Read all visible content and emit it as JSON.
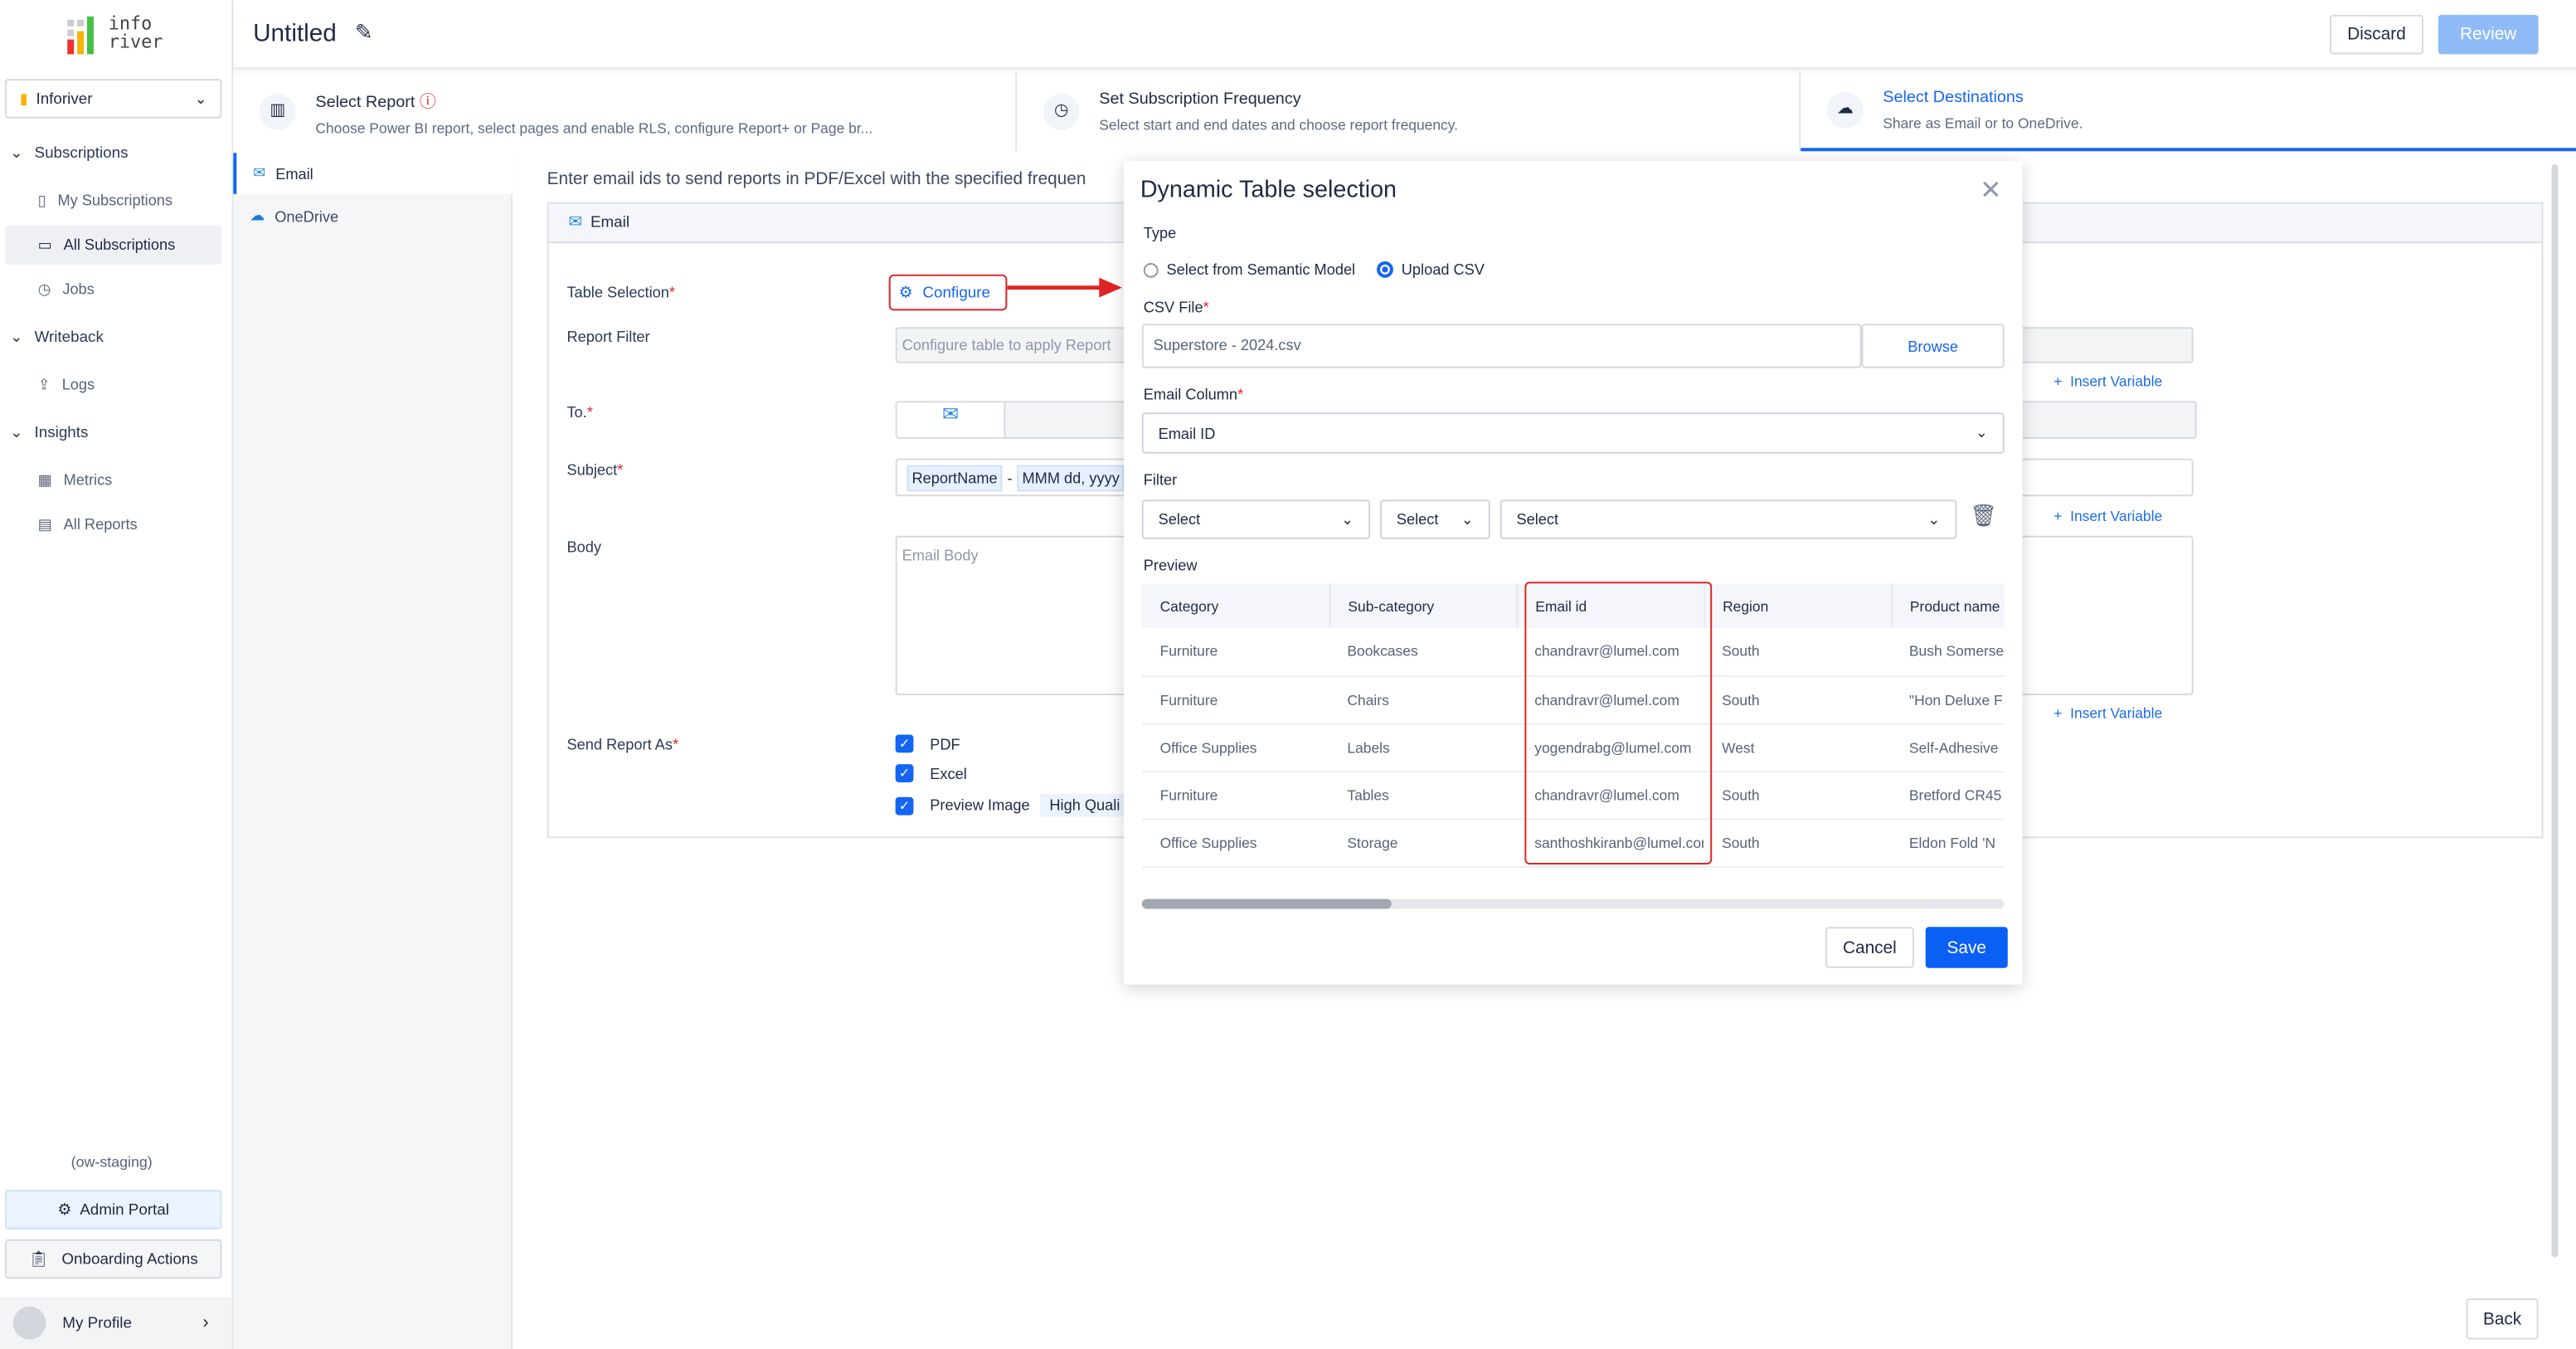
{
  "app": {
    "logo_text": "info river",
    "title": "Untitled",
    "discard": "Discard",
    "review": "Review",
    "back": "Back"
  },
  "sidebar": {
    "workspace": "Inforiver",
    "groups": [
      {
        "label": "Subscriptions",
        "items": [
          "My Subscriptions",
          "All Subscriptions",
          "Jobs"
        ]
      },
      {
        "label": "Writeback",
        "items": [
          "Logs"
        ]
      },
      {
        "label": "Insights",
        "items": [
          "Metrics",
          "All Reports"
        ]
      }
    ],
    "env": "(ow-staging)",
    "admin": "Admin Portal",
    "onboarding": "Onboarding Actions",
    "profile": "My Profile"
  },
  "steps": [
    {
      "title": "Select Report",
      "desc": "Choose Power BI report, select pages and enable RLS, configure Report+ or Page br..."
    },
    {
      "title": "Set Subscription Frequency",
      "desc": "Select start and end dates and choose report frequency."
    },
    {
      "title": "Select Destinations",
      "desc": "Share as Email or to OneDrive."
    }
  ],
  "destinations": [
    "Email",
    "OneDrive"
  ],
  "main": {
    "intro": "Enter email ids to send reports in PDF/Excel with the specified frequen",
    "panel_title": "Email",
    "table_selection": "Table Selection",
    "configure": "Configure",
    "report_filter": "Report Filter",
    "report_filter_placeholder": "Configure table to apply Report",
    "to": "To.",
    "subject": "Subject",
    "subject_tokens": [
      "ReportName",
      "-",
      "MMM dd, yyyy"
    ],
    "body": "Body",
    "body_placeholder": "Email Body",
    "send_as": "Send Report As",
    "formats": [
      "PDF",
      "Excel",
      "Preview Image"
    ],
    "quality": "High Quali",
    "insert_variable": "Insert Variable"
  },
  "modal": {
    "title": "Dynamic Table selection",
    "type_label": "Type",
    "type_options": [
      "Select from Semantic Model",
      "Upload CSV"
    ],
    "type_selected": "Upload CSV",
    "csv_label": "CSV File",
    "csv_value": "Superstore - 2024.csv",
    "browse": "Browse",
    "email_col_label": "Email Column",
    "email_col_value": "Email ID",
    "filter_label": "Filter",
    "filter_selects": [
      "Select",
      "Select",
      "Select"
    ],
    "preview_label": "Preview",
    "columns": [
      "Category",
      "Sub-category",
      "Email id",
      "Region",
      "Product name"
    ],
    "rows": [
      [
        "Furniture",
        "Bookcases",
        "chandravr@lumel.com",
        "South",
        "Bush Somerse"
      ],
      [
        "Furniture",
        "Chairs",
        "chandravr@lumel.com",
        "South",
        "\"Hon Deluxe F"
      ],
      [
        "Office Supplies",
        "Labels",
        "yogendrabg@lumel.com",
        "West",
        "Self-Adhesive"
      ],
      [
        "Furniture",
        "Tables",
        "chandravr@lumel.com",
        "South",
        "Bretford CR45"
      ],
      [
        "Office Supplies",
        "Storage",
        "santhoshkiranb@lumel.com",
        "South",
        "Eldon Fold 'N"
      ]
    ],
    "cancel": "Cancel",
    "save": "Save"
  },
  "colors": {
    "accent": "#1565f5",
    "highlight": "#e02424"
  }
}
